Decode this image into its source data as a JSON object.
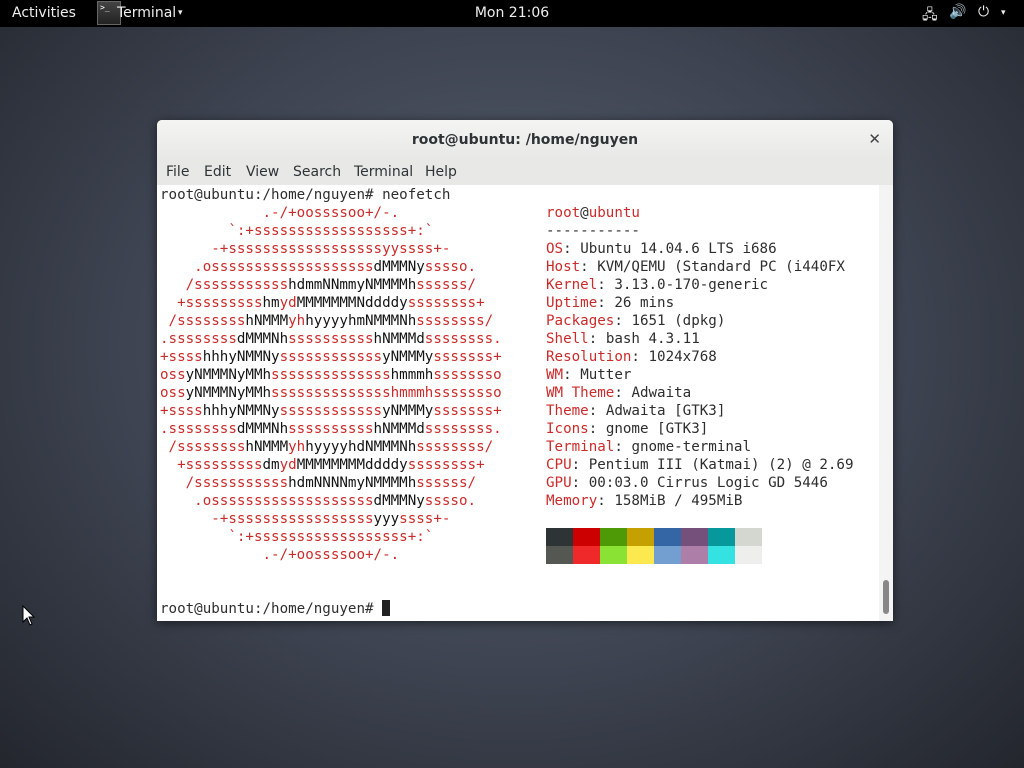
{
  "topbar": {
    "activities": "Activities",
    "app_name": "Terminal",
    "app_arrow": "▾",
    "clock": "Mon 21:06",
    "tray": {
      "network": "🖧",
      "volume": "🔊",
      "power": "⏻",
      "power_arrow": "▾"
    }
  },
  "window": {
    "title": "root@ubuntu: /home/nguyen",
    "close": "✕",
    "menu": [
      "File",
      "Edit",
      "View",
      "Search",
      "Terminal",
      "Help"
    ]
  },
  "terminal": {
    "command_line": "root@ubuntu:/home/nguyen# neofetch",
    "prompt": "root@ubuntu:/home/nguyen# ",
    "logo": [
      [
        [
          "r",
          "            .-/+oossssoo+/-."
        ]
      ],
      [
        [
          "r",
          "        `:+ssssssssssssssssss+:`"
        ]
      ],
      [
        [
          "r",
          "      -+ssssssssssssssssssyyssss+-"
        ]
      ],
      [
        [
          "r",
          "    .osssssssssssssssssss"
        ],
        [
          "k",
          "dMMMNy"
        ],
        [
          "r",
          "sssso."
        ]
      ],
      [
        [
          "r",
          "   /sssssssssss"
        ],
        [
          "k",
          "hdmmNNmmyNMMMMh"
        ],
        [
          "r",
          "ssssss/"
        ]
      ],
      [
        [
          "r",
          "  +sssssssss"
        ],
        [
          "k",
          "hm"
        ],
        [
          "r",
          "yd"
        ],
        [
          "k",
          "MMMMMMMNddddy"
        ],
        [
          "r",
          "ssssssss+"
        ]
      ],
      [
        [
          "r",
          " /ssssssss"
        ],
        [
          "k",
          "hNMMM"
        ],
        [
          "r",
          "yh"
        ],
        [
          "k",
          "hyyyyhmNMMMNh"
        ],
        [
          "r",
          "ssssssss/"
        ]
      ],
      [
        [
          "r",
          ".ssssssss"
        ],
        [
          "k",
          "dMMMNh"
        ],
        [
          "r",
          "ssssssssss"
        ],
        [
          "k",
          "hNMMMd"
        ],
        [
          "r",
          "ssssssss."
        ]
      ],
      [
        [
          "r",
          "+ssss"
        ],
        [
          "k",
          "hhhyNMMNy"
        ],
        [
          "r",
          "ssssssssssss"
        ],
        [
          "k",
          "yNMMMy"
        ],
        [
          "r",
          "sssssss+"
        ]
      ],
      [
        [
          "r",
          "oss"
        ],
        [
          "k",
          "yNMMMNyMMh"
        ],
        [
          "r",
          "ssssssssssssss"
        ],
        [
          "k",
          "hmmmh"
        ],
        [
          "r",
          "ssssssso"
        ]
      ],
      [
        [
          "r",
          "oss"
        ],
        [
          "k",
          "yNMMMNyMMh"
        ],
        [
          "r",
          "sssssssssssssshmmmhssssssso"
        ]
      ],
      [
        [
          "r",
          "+ssss"
        ],
        [
          "k",
          "hhhyNMMNy"
        ],
        [
          "r",
          "ssssssssssss"
        ],
        [
          "k",
          "yNMMMy"
        ],
        [
          "r",
          "sssssss+"
        ]
      ],
      [
        [
          "r",
          ".ssssssss"
        ],
        [
          "k",
          "dMMMNh"
        ],
        [
          "r",
          "ssssssssss"
        ],
        [
          "k",
          "hNMMMd"
        ],
        [
          "r",
          "ssssssss."
        ]
      ],
      [
        [
          "r",
          " /ssssssss"
        ],
        [
          "k",
          "hNMMM"
        ],
        [
          "r",
          "yh"
        ],
        [
          "k",
          "hyyyyhdNMMMNh"
        ],
        [
          "r",
          "ssssssss/"
        ]
      ],
      [
        [
          "r",
          "  +sssssssss"
        ],
        [
          "k",
          "dm"
        ],
        [
          "r",
          "yd"
        ],
        [
          "k",
          "MMMMMMMMddddy"
        ],
        [
          "r",
          "ssssssss+"
        ]
      ],
      [
        [
          "r",
          "   /sssssssssss"
        ],
        [
          "k",
          "hdmNNNNmyNMMMMh"
        ],
        [
          "r",
          "ssssss/"
        ]
      ],
      [
        [
          "r",
          "    .osssssssssssssssssss"
        ],
        [
          "k",
          "dMMMNy"
        ],
        [
          "r",
          "sssso."
        ]
      ],
      [
        [
          "r",
          "      -+sssssssssssssssss"
        ],
        [
          "k",
          "yyy"
        ],
        [
          "r",
          "ssss+-"
        ]
      ],
      [
        [
          "r",
          "        `:+ssssssssssssssssss+:`"
        ]
      ],
      [
        [
          "r",
          "            .-/+oossssoo+/-."
        ]
      ]
    ],
    "user": "root",
    "at": "@",
    "host": "ubuntu",
    "separator": "-----------",
    "info": [
      {
        "key": "OS",
        "value": "Ubuntu 14.04.6 LTS i686"
      },
      {
        "key": "Host",
        "value": "KVM/QEMU (Standard PC (i440FX"
      },
      {
        "key": "Kernel",
        "value": "3.13.0-170-generic"
      },
      {
        "key": "Uptime",
        "value": "26 mins"
      },
      {
        "key": "Packages",
        "value": "1651 (dpkg)"
      },
      {
        "key": "Shell",
        "value": "bash 4.3.11"
      },
      {
        "key": "Resolution",
        "value": "1024x768"
      },
      {
        "key": "WM",
        "value": "Mutter"
      },
      {
        "key": "WM Theme",
        "value": "Adwaita"
      },
      {
        "key": "Theme",
        "value": "Adwaita [GTK3]"
      },
      {
        "key": "Icons",
        "value": "gnome [GTK3]"
      },
      {
        "key": "Terminal",
        "value": "gnome-terminal"
      },
      {
        "key": "CPU",
        "value": "Pentium III (Katmai) (2) @ 2.69"
      },
      {
        "key": "GPU",
        "value": "00:03.0 Cirrus Logic GD 5446"
      },
      {
        "key": "Memory",
        "value": "158MiB / 495MiB"
      }
    ],
    "colors_top": [
      "#2e3436",
      "#cc0000",
      "#4e9a06",
      "#c4a000",
      "#3465a4",
      "#75507b",
      "#06989a",
      "#d3d7cf"
    ],
    "colors_bottom": [
      "#555753",
      "#ef2929",
      "#8ae234",
      "#fce94f",
      "#729fcf",
      "#ad7fa8",
      "#34e2e2",
      "#eeeeec"
    ]
  }
}
